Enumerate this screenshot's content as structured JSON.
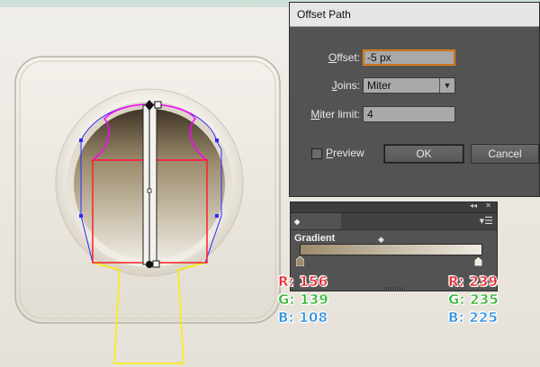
{
  "dialog": {
    "title": "Offset Path",
    "offset_label": "Offset:",
    "offset_value": "-5 px",
    "joins_label": "Joins:",
    "joins_value": "Miter",
    "miter_label": "Miter limit:",
    "miter_value": "4",
    "preview_label": "Preview",
    "preview_checked": false,
    "ok_label": "OK",
    "cancel_label": "Cancel"
  },
  "gradient_panel": {
    "tab_label": "Gradient",
    "collapse_glyph": "◂◂",
    "close_glyph": "✕",
    "menu_glyph": "▾☰",
    "start_color": "#9c8b6c",
    "end_color": "#efebe1"
  },
  "readouts": {
    "left": {
      "r_label": "R:",
      "r": "156",
      "g_label": "G:",
      "g": "139",
      "b_label": "B:",
      "b": "108"
    },
    "right": {
      "r_label": "R:",
      "r": "239",
      "g_label": "G:",
      "g": "235",
      "b_label": "B:",
      "b": "225"
    }
  },
  "colors": {
    "r_text": "#e8262b",
    "g_text": "#2fb52f",
    "b_text": "#2b8fe0",
    "magenta_path": "#ff00ff",
    "blue_path": "#2a2aff",
    "red_path": "#ff2020",
    "yellow_path": "#ffee00"
  }
}
